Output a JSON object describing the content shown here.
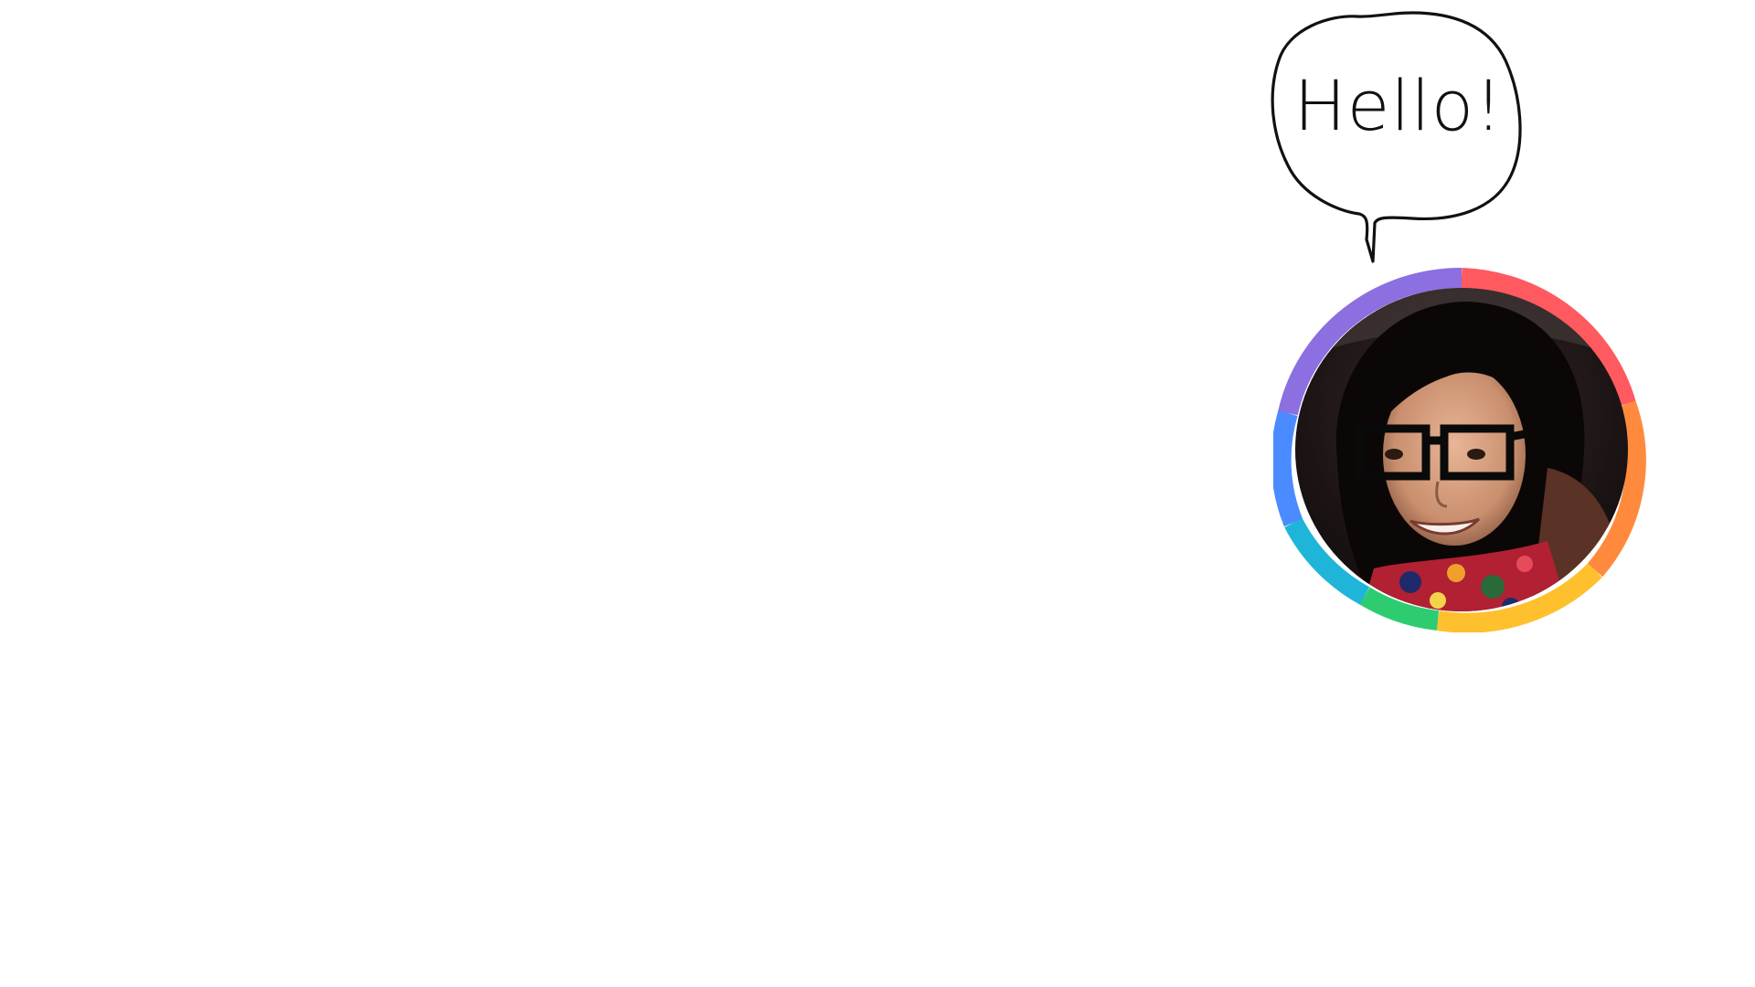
{
  "speech_bubble": {
    "text": "Hello!"
  },
  "avatar": {
    "icon": "profile-photo",
    "ring_colors": [
      "#ff5a5f",
      "#ff8a3d",
      "#ffc02e",
      "#2ecc71",
      "#1fb5d8",
      "#4a8cff",
      "#8c6fe0"
    ]
  }
}
